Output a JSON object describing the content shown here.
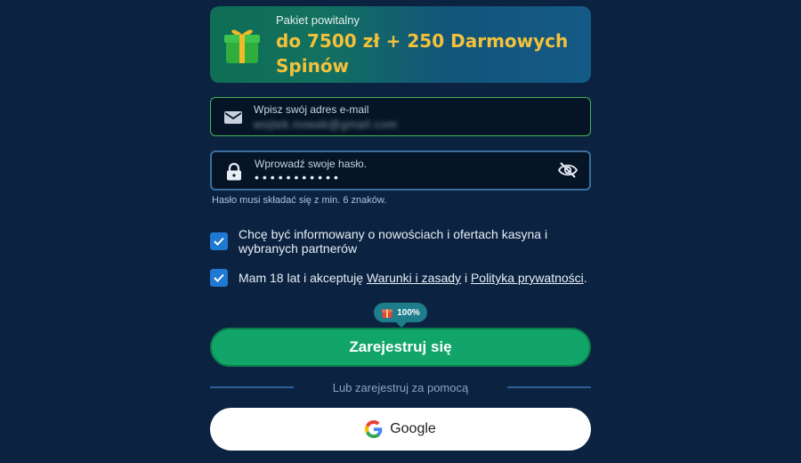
{
  "banner": {
    "kicker": "Pakiet powitalny",
    "headline": "do 7500 zł + 250 Darmowych Spinów"
  },
  "email_field": {
    "label": "Wpisz swój adres e-mail",
    "value_obscured": "wojtek.nowak@gmail.com"
  },
  "password_field": {
    "label": "Wprowadź swoje hasło.",
    "value_masked": "•••••••••••"
  },
  "password_hint": "Hasło musi składać się z min. 6 znaków.",
  "consents": {
    "marketing": {
      "text": "Chcę być informowany o nowościach i ofertach kasyna i wybranych partnerów",
      "checked": true
    },
    "terms": {
      "prefix": "Mam 18 lat i akceptuję",
      "terms_link": "Warunki i zasady",
      "joiner": "i",
      "privacy_link": "Polityka prywatności",
      "suffix": ".",
      "checked": true
    }
  },
  "bonus_badge": {
    "value": "100%"
  },
  "register_button": "Zarejestruj się",
  "divider_text": "Lub zarejestruj za pomocą",
  "google_button": "Google",
  "colors": {
    "background": "#0b2340",
    "primary_green": "#12a56a",
    "checkbox_blue": "#1f78d2",
    "headline_gold": "#f3c13a"
  }
}
